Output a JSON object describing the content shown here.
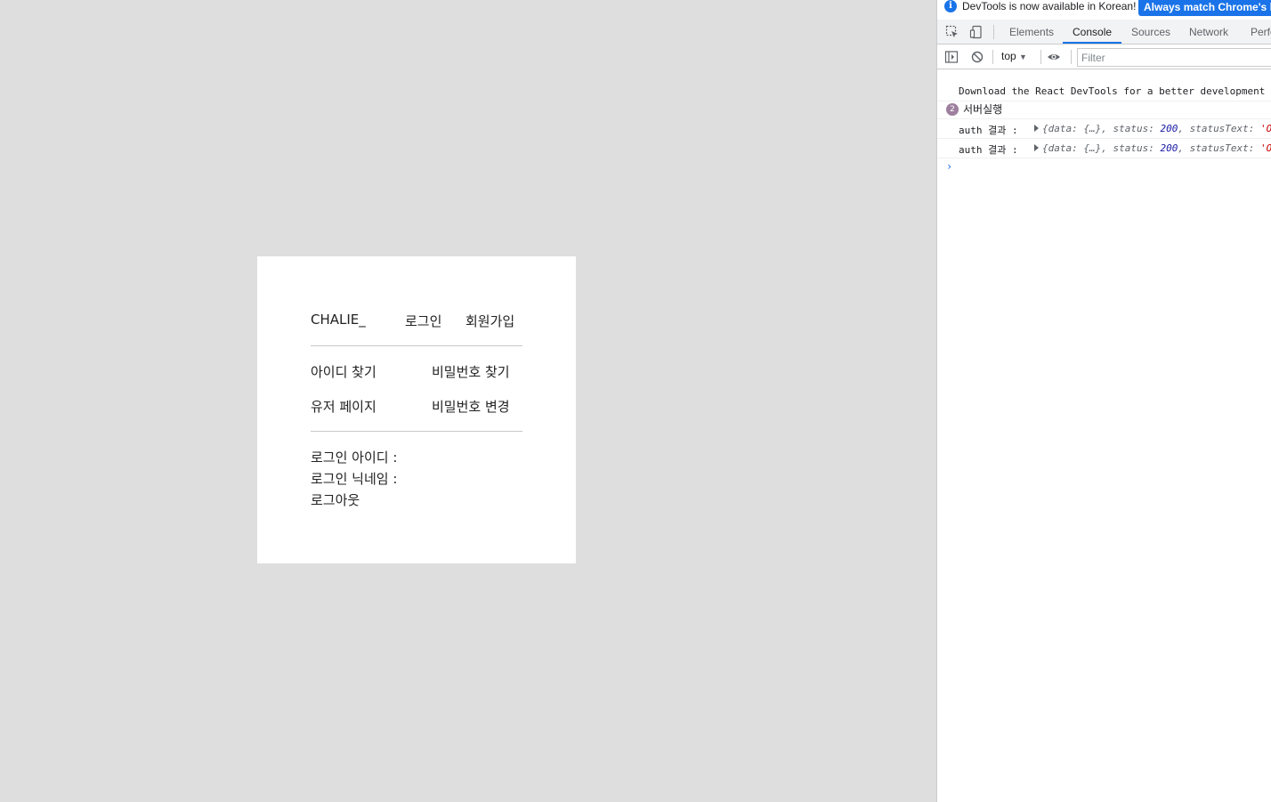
{
  "app": {
    "brand": "CHALIE_",
    "nav": {
      "login": "로그인",
      "signup": "회원가입"
    },
    "links": {
      "find_id": "아이디 찾기",
      "find_password": "비밀번호 찾기",
      "user_page": "유저 페이지",
      "change_password": "비밀번호 변경"
    },
    "info": {
      "login_id_label": "로그인 아이디 :",
      "login_nickname_label": "로그인 닉네임 :",
      "logout": "로그아웃"
    }
  },
  "devtools": {
    "infobar": {
      "text": "DevTools is now available in Korean!",
      "button": "Always match Chrome's language"
    },
    "tabs": [
      "Elements",
      "Console",
      "Sources",
      "Network",
      "Performance"
    ],
    "active_tab": "Console",
    "context": "top",
    "filter_placeholder": "Filter",
    "messages": {
      "m1": "Download the React DevTools for a better development experience",
      "m2_count": "2",
      "m2": "서버실행",
      "m3_label": "auth 결과 :",
      "m3_obj_a": "{data: {…}, status: ",
      "m3_status": "200",
      "m3_obj_b": ", statusText: ",
      "m3_text": "'OK'",
      "m4_label": "auth 결과 :",
      "m4_obj_a": "{data: {…}, status: ",
      "m4_status": "200",
      "m4_obj_b": ", statusText: ",
      "m4_text": "'OK'"
    },
    "prompt": "›",
    "colors": {
      "accent": "#1a73e8",
      "badge": "#9e7f9e"
    }
  }
}
